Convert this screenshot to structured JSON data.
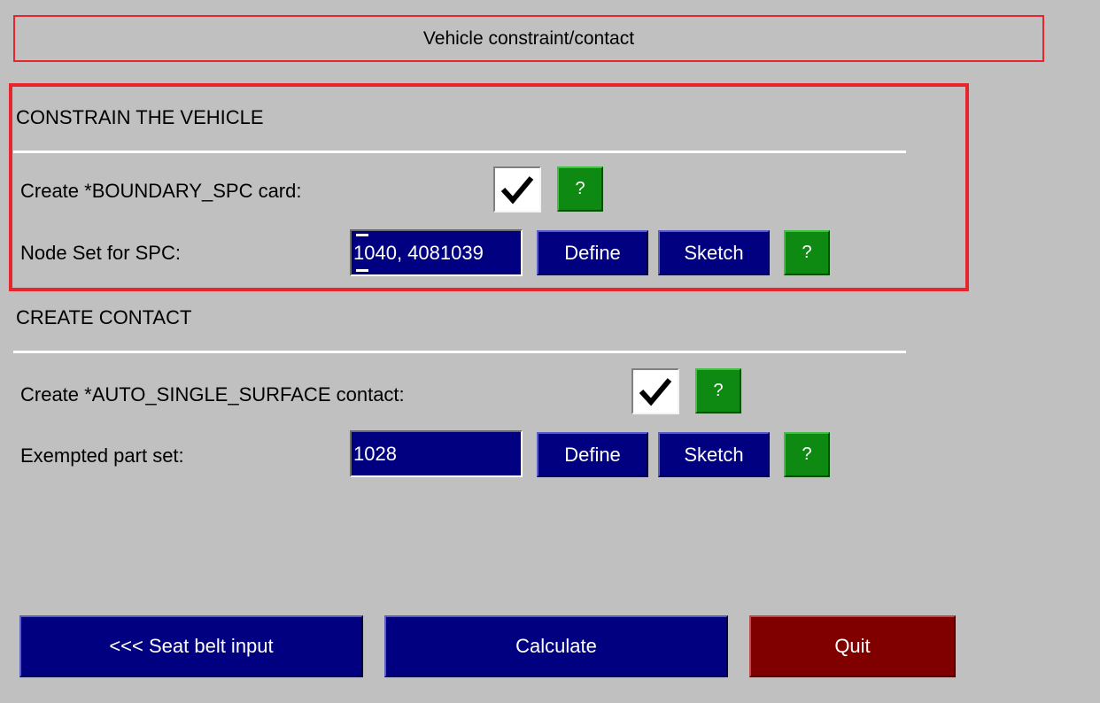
{
  "window": {
    "title": "Vehicle constraint/contact"
  },
  "constrain": {
    "heading": "CONSTRAIN THE VEHICLE",
    "boundary_label": "Create *BOUNDARY_SPC card:",
    "boundary_checked": true,
    "help_label": "?",
    "node_set_label": "Node Set for SPC:",
    "node_set_value": "1040, 4081039",
    "define_label": "Define",
    "sketch_label": "Sketch"
  },
  "contact": {
    "heading": "CREATE CONTACT",
    "auto_label": "Create *AUTO_SINGLE_SURFACE contact:",
    "auto_checked": true,
    "help_label": "?",
    "exempted_label": "Exempted part set:",
    "exempted_value": "1028",
    "define_label": "Define",
    "sketch_label": "Sketch"
  },
  "footer": {
    "back_label": "<<< Seat belt input",
    "calculate_label": "Calculate",
    "quit_label": "Quit"
  },
  "colors": {
    "highlight": "#e8242c",
    "field_blue": "#000080",
    "help_green": "#0e8a13",
    "quit_red": "#800000",
    "background": "#c0c0c0"
  },
  "icons": {
    "checkmark": "checkmark-icon"
  }
}
